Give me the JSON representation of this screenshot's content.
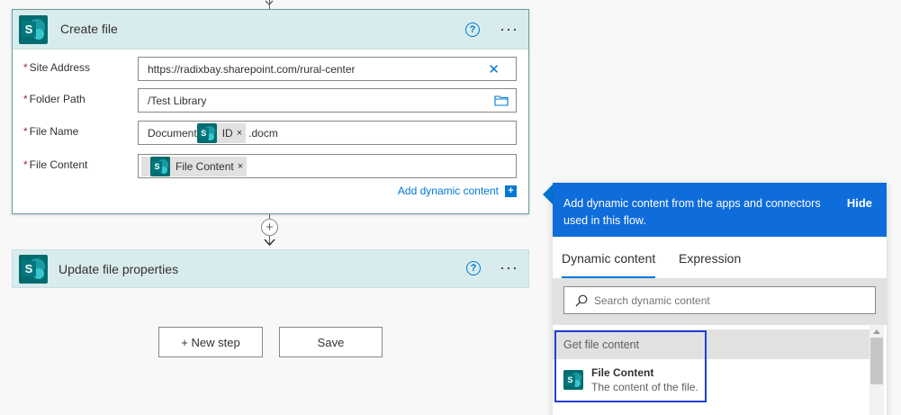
{
  "create_card": {
    "title": "Create file",
    "help_glyph": "?",
    "more_glyph": "···",
    "logo_letter": "S",
    "fields": [
      {
        "label": "Site Address",
        "value": "https://radixbay.sharepoint.com/rural-center"
      },
      {
        "label": "Folder Path",
        "value": "/Test Library"
      },
      {
        "label": "File Name",
        "prefix": "Document",
        "token": "ID",
        "suffix": ".docm"
      },
      {
        "label": "File Content",
        "token": "File Content"
      }
    ],
    "required_mark": "*",
    "clear_glyph": "✕",
    "token_close": "×",
    "add_dynamic": "Add dynamic content",
    "add_dynamic_glyph": "+"
  },
  "connector": {
    "add_glyph": "+"
  },
  "update_card": {
    "title": "Update file properties",
    "help_glyph": "?",
    "more_glyph": "···"
  },
  "actions": {
    "new_step": "+ New step",
    "save": "Save"
  },
  "dynamic_panel": {
    "message": "Add dynamic content from the apps and connectors used in this flow.",
    "hide": "Hide",
    "tabs": [
      "Dynamic content",
      "Expression"
    ],
    "search_placeholder": "Search dynamic content",
    "group": "Get file content",
    "items": [
      {
        "title": "File Content",
        "description": "The content of the file."
      }
    ]
  },
  "colors": {
    "accent": "#0078d4",
    "panel_header": "#0f6cdb",
    "sharepoint": "#036c70",
    "card_header": "#d9eced",
    "highlight": "#1f3fd6",
    "required": "#a4262c"
  },
  "icons": [
    "sharepoint-logo-icon",
    "help-icon",
    "more-icon",
    "clear-icon",
    "folder-icon",
    "plus-icon",
    "search-icon",
    "chevron-down-icon"
  ]
}
